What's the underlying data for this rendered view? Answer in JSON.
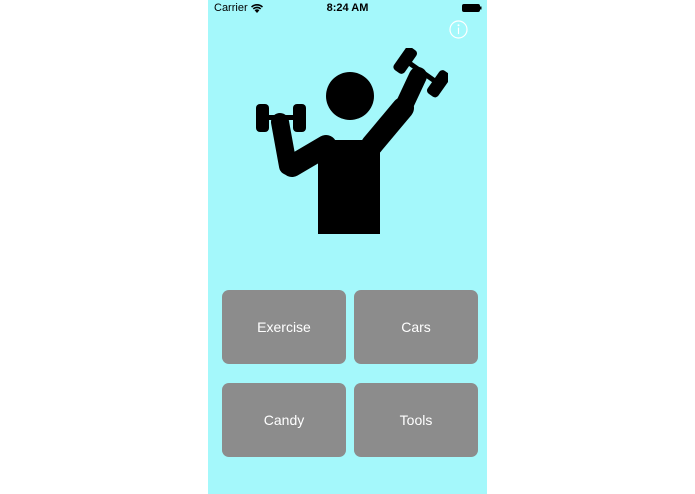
{
  "status_bar": {
    "carrier": "Carrier",
    "time": "8:24 AM"
  },
  "icons": {
    "wifi": "wifi-icon",
    "battery": "battery-icon",
    "info": "info-icon",
    "hero": "weightlifter-icon"
  },
  "colors": {
    "background": "#a4f8fb",
    "button_fill": "#8c8c8c",
    "button_text": "#ffffff"
  },
  "categories": [
    {
      "label": "Exercise"
    },
    {
      "label": "Cars"
    },
    {
      "label": "Candy"
    },
    {
      "label": "Tools"
    }
  ]
}
